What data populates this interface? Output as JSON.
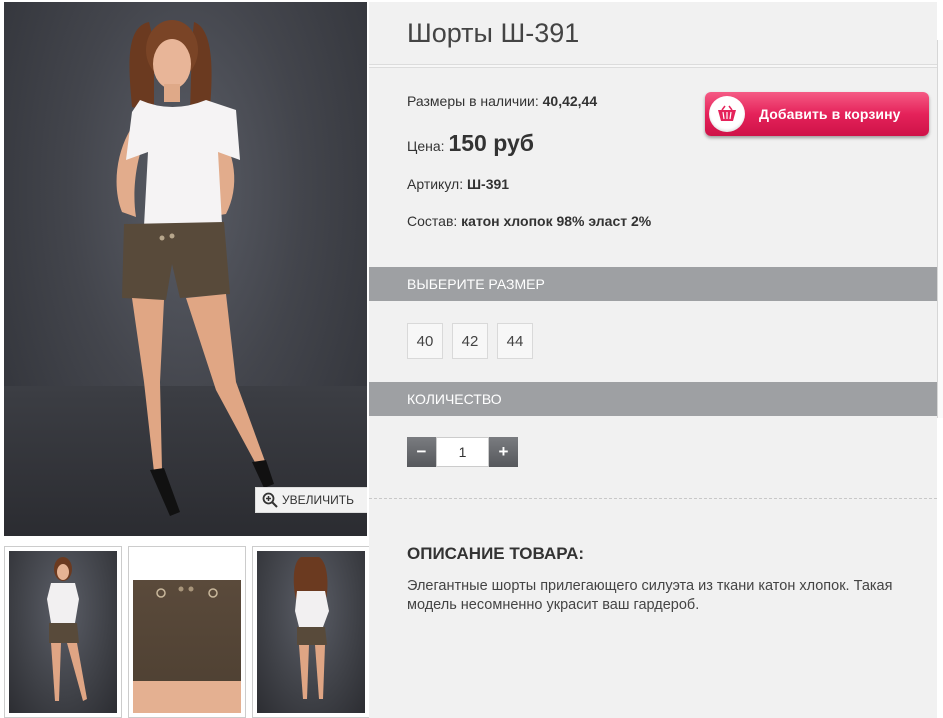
{
  "product": {
    "title": "Шорты Ш-391",
    "sizes_available_label": "Размеры в наличии:",
    "sizes_available_value": "40,42,44",
    "price_label": "Цена:",
    "price_value": "150 руб",
    "sku_label": "Артикул:",
    "sku_value": "Ш-391",
    "composition_label": "Состав:",
    "composition_value": "катон хлопок 98% эласт 2%"
  },
  "gallery": {
    "zoom_label": "УВЕЛИЧИТЬ",
    "zoom_icon": "magnifier-plus-icon"
  },
  "cart": {
    "button_label": "Добавить в корзину",
    "icon": "basket-icon",
    "accent_color": "#e5225a"
  },
  "size_section": {
    "heading": "ВЫБЕРИТЕ РАЗМЕР",
    "options": [
      "40",
      "42",
      "44"
    ]
  },
  "quantity_section": {
    "heading": "КОЛИЧЕСТВО",
    "minus_label": "−",
    "plus_label": "+",
    "value": "1"
  },
  "description": {
    "heading": "ОПИСАНИЕ ТОВАРА:",
    "text": "Элегантные шорты прилегающего силуэта из ткани катон хлопок. Такая модель несомненно украсит ваш гардероб."
  }
}
